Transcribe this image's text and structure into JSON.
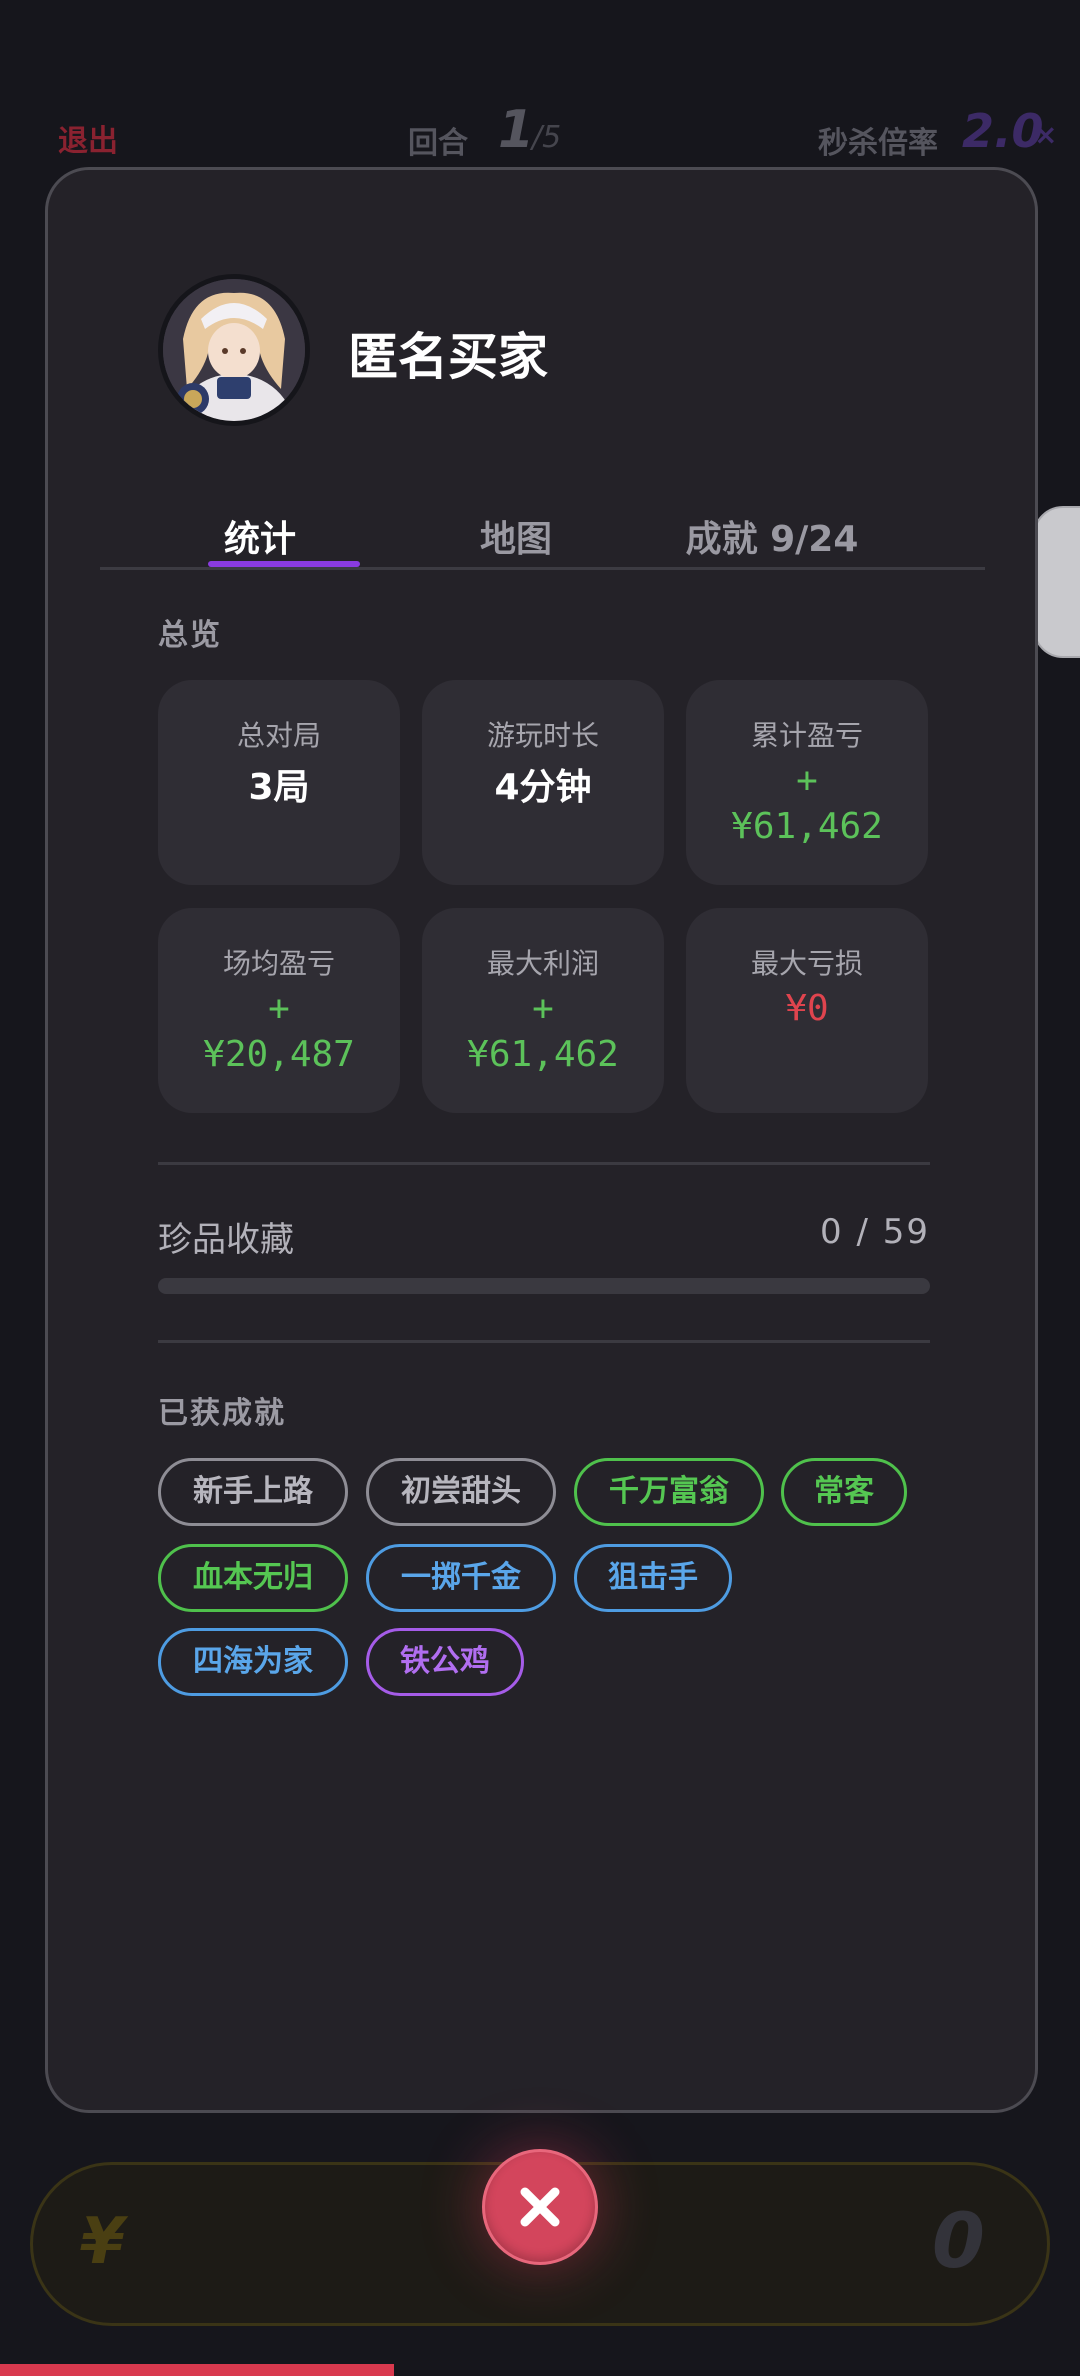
{
  "background": {
    "exit_label": "退出",
    "round_label": "回合",
    "round_current": "1",
    "round_total": "/5",
    "rate_label": "秒杀倍率",
    "rate_value": "2.0",
    "rate_suffix": "×",
    "balance_currency": "¥",
    "balance_value": "0"
  },
  "profile": {
    "username": "匿名买家",
    "avatar_icon": "anime-girl-avatar"
  },
  "tabs": [
    {
      "label": "统计",
      "active": true
    },
    {
      "label": "地图",
      "active": false
    },
    {
      "label": "成就 9/24",
      "active": false
    }
  ],
  "overview": {
    "title": "总览",
    "stats": [
      {
        "label": "总对局",
        "value": "3局"
      },
      {
        "label": "游玩时长",
        "value": "4分钟"
      },
      {
        "label": "累计盈亏",
        "value_sign": "+",
        "value": "¥61,462"
      },
      {
        "label": "场均盈亏",
        "value_sign": "+",
        "value": "¥20,487"
      },
      {
        "label": "最大利润",
        "value_sign": "+",
        "value": "¥61,462"
      },
      {
        "label": "最大亏损",
        "value": "¥0"
      }
    ]
  },
  "collection": {
    "label": "珍品收藏",
    "count_text": "0 / 59",
    "progress": 0
  },
  "achievements": {
    "title": "已获成就",
    "badges": [
      {
        "label": "新手上路",
        "color": "gray"
      },
      {
        "label": "初尝甜头",
        "color": "gray"
      },
      {
        "label": "千万富翁",
        "color": "green"
      },
      {
        "label": "常客",
        "color": "green"
      },
      {
        "label": "血本无归",
        "color": "green"
      },
      {
        "label": "一掷千金",
        "color": "blue"
      },
      {
        "label": "狙击手",
        "color": "blue"
      },
      {
        "label": "四海为家",
        "color": "blue"
      },
      {
        "label": "铁公鸡",
        "color": "purple"
      }
    ]
  },
  "colors": {
    "accent": "#8a3be0",
    "positive": "#5cc25a",
    "negative": "#e0444e",
    "close_button": "#d3455c"
  }
}
